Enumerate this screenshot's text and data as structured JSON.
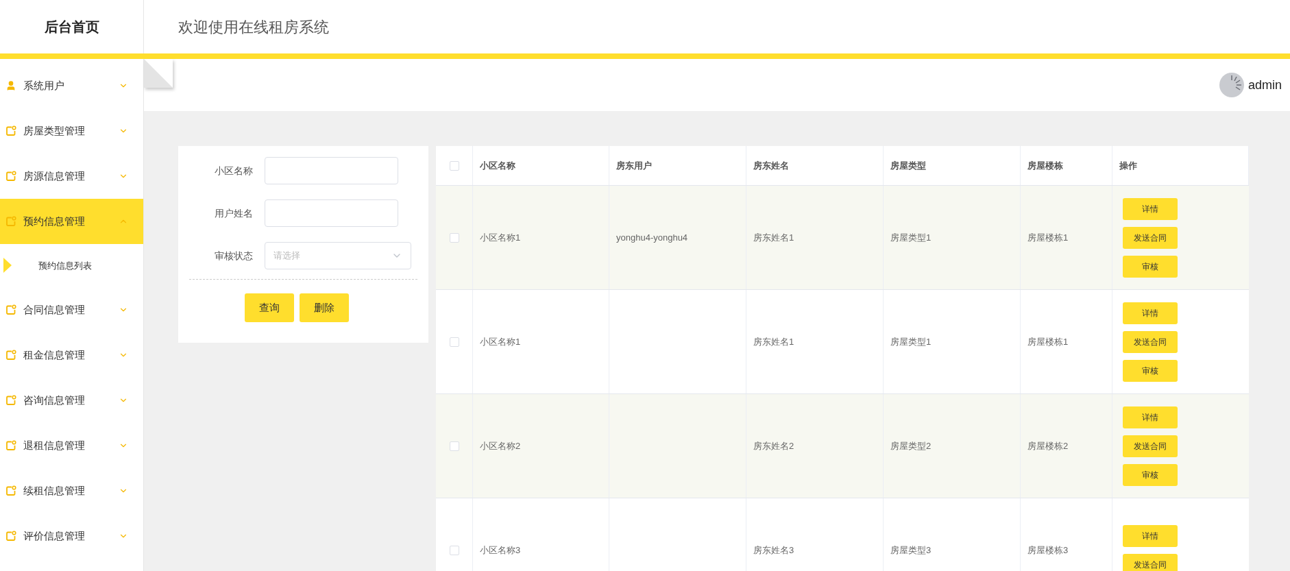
{
  "sidebar": {
    "title": "后台首页",
    "items": [
      {
        "label": "系统用户",
        "kind": "user",
        "expanded": false,
        "selected": false
      },
      {
        "label": "房屋类型管理",
        "kind": "note",
        "expanded": false,
        "selected": false
      },
      {
        "label": "房源信息管理",
        "kind": "note",
        "expanded": false,
        "selected": false
      },
      {
        "label": "预约信息管理",
        "kind": "note",
        "expanded": true,
        "selected": true,
        "children": [
          {
            "label": "预约信息列表",
            "selected": true
          }
        ]
      },
      {
        "label": "合同信息管理",
        "kind": "note",
        "expanded": false,
        "selected": false
      },
      {
        "label": "租金信息管理",
        "kind": "note",
        "expanded": false,
        "selected": false
      },
      {
        "label": "咨询信息管理",
        "kind": "note",
        "expanded": false,
        "selected": false
      },
      {
        "label": "退租信息管理",
        "kind": "note",
        "expanded": false,
        "selected": false
      },
      {
        "label": "续租信息管理",
        "kind": "note",
        "expanded": false,
        "selected": false
      },
      {
        "label": "评价信息管理",
        "kind": "note",
        "expanded": false,
        "selected": false
      }
    ]
  },
  "header": {
    "title": "欢迎使用在线租房系统"
  },
  "user": {
    "name": "admin"
  },
  "search_form": {
    "fields": [
      {
        "label": "小区名称",
        "kind": "input"
      },
      {
        "label": "用户姓名",
        "kind": "input"
      },
      {
        "label": "审核状态",
        "kind": "select",
        "placeholder": "请选择"
      }
    ],
    "buttons": [
      "查询",
      "删除"
    ]
  },
  "table": {
    "select_all": {
      "checked": false
    },
    "columns": [
      "小区名称",
      "房东用户",
      "房东姓名",
      "房屋类型",
      "房屋楼栋",
      "操作"
    ],
    "rows": [
      {
        "checked": false,
        "cells": [
          "小区名称1",
          "yonghu4-yonghu4",
          "房东姓名1",
          "房屋类型1",
          "房屋楼栋1"
        ],
        "actions": [
          "详情",
          "发送合同",
          "审核"
        ]
      },
      {
        "checked": false,
        "cells": [
          "小区名称1",
          "",
          "房东姓名1",
          "房屋类型1",
          "房屋楼栋1"
        ],
        "actions": [
          "详情",
          "发送合同",
          "审核"
        ]
      },
      {
        "checked": false,
        "cells": [
          "小区名称2",
          "",
          "房东姓名2",
          "房屋类型2",
          "房屋楼栋2"
        ],
        "actions": [
          "详情",
          "发送合同",
          "审核"
        ]
      },
      {
        "checked": false,
        "cells": [
          "小区名称3",
          "",
          "房东姓名3",
          "房屋类型3",
          "房屋楼栋3"
        ],
        "actions": [
          "详情",
          "发送合同"
        ]
      }
    ]
  }
}
